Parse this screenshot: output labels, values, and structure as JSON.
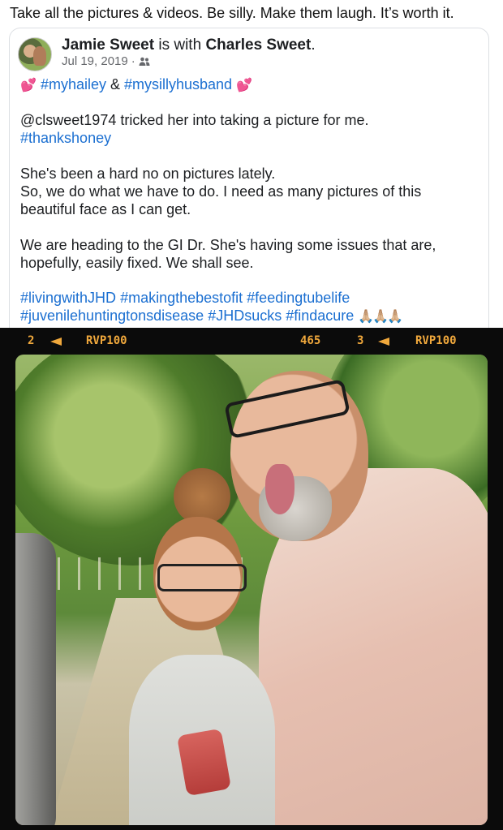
{
  "caption": "Take all the pictures & videos. Be silly. Make them laugh. It’s worth it.",
  "post": {
    "author": "Jamie Sweet",
    "with_text": " is with ",
    "tagged": "Charles Sweet",
    "tagged_suffix": ".",
    "date": "Jul 19, 2019",
    "dot": "·",
    "audience_icon": "friends-icon",
    "line1": {
      "emoji_left": "💕",
      "tag1": "#myhailey",
      "amp": " & ",
      "tag2": "#mysillyhusband",
      "emoji_right": "💕"
    },
    "para1_line1": "@clsweet1974 tricked her into taking a picture for me.",
    "para1_tag": "#thankshoney",
    "para2_line1": "She's been a hard no on pictures lately.",
    "para2_line2": "So, we do what we have to do. I need as many pictures of this",
    "para2_line3": "beautiful face as I can get.",
    "para3_line1": "We are heading to the GI Dr. She's having some issues that are,",
    "para3_line2": "hopefully, easily fixed. We shall see.",
    "hashtags_row1": [
      "#livingwithJHD",
      "#makingthebestofit",
      "#feedingtubelife"
    ],
    "hashtags_row2": [
      "#juvenilehuntingtonsdisease",
      "#JHDsucks",
      "#findacure"
    ],
    "hands_emoji": "🙏🏼🙏🏼🙏🏼"
  },
  "photo": {
    "film_left_num": "2",
    "film_left_code": "RVP100",
    "film_mid_num": "465",
    "film_right_num": "3",
    "film_right_code": "RVP100",
    "accent": "#f0a83c"
  }
}
